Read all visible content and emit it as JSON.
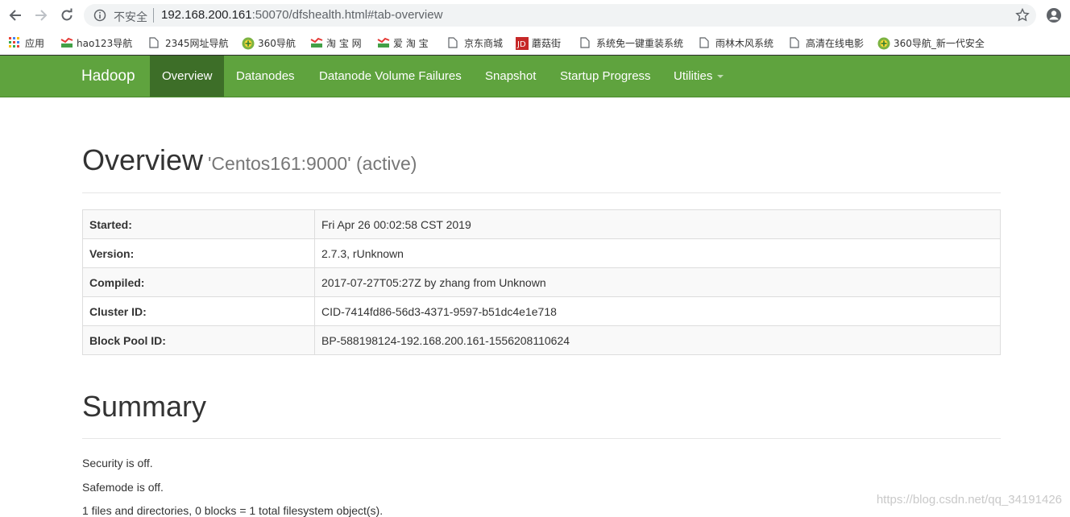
{
  "browser": {
    "insecure_label": "不安全",
    "url_host": "192.168.200.161",
    "url_rest": ":50070/dfshealth.html#tab-overview",
    "bookmarks": [
      {
        "label": "应用",
        "icon": "apps-grid-icon"
      },
      {
        "label": "hao123导航",
        "icon": "hao-icon"
      },
      {
        "label": "2345网址导航",
        "icon": "page-icon"
      },
      {
        "label": "360导航",
        "icon": "360-icon"
      },
      {
        "label": "淘 宝 网",
        "icon": "hao-icon"
      },
      {
        "label": "爱 淘 宝",
        "icon": "hao-icon"
      },
      {
        "label": "京东商城",
        "icon": "page-icon"
      },
      {
        "label": "蘑菇街",
        "icon": "jd-icon"
      },
      {
        "label": "系统免一键重装系统",
        "icon": "page-icon"
      },
      {
        "label": "雨林木风系统",
        "icon": "page-icon"
      },
      {
        "label": "高清在线电影",
        "icon": "page-icon"
      },
      {
        "label": "360导航_新一代安全",
        "icon": "360-icon"
      }
    ]
  },
  "navbar": {
    "brand": "Hadoop",
    "items": [
      "Overview",
      "Datanodes",
      "Datanode Volume Failures",
      "Snapshot",
      "Startup Progress",
      "Utilities"
    ],
    "active": "Overview",
    "color": "#5fa33e"
  },
  "overview": {
    "title": "Overview",
    "subtitle": "'Centos161:9000' (active)",
    "rows": [
      {
        "key": "Started:",
        "value": "Fri Apr 26 00:02:58 CST 2019"
      },
      {
        "key": "Version:",
        "value": "2.7.3, rUnknown"
      },
      {
        "key": "Compiled:",
        "value": "2017-07-27T05:27Z by zhang from Unknown"
      },
      {
        "key": "Cluster ID:",
        "value": "CID-7414fd86-56d3-4371-9597-b51dc4e1e718"
      },
      {
        "key": "Block Pool ID:",
        "value": "BP-588198124-192.168.200.161-1556208110624"
      }
    ]
  },
  "summary": {
    "title": "Summary",
    "lines": [
      "Security is off.",
      "Safemode is off.",
      "1 files and directories, 0 blocks = 1 total filesystem object(s)."
    ]
  },
  "watermark": "https://blog.csdn.net/qq_34191426"
}
